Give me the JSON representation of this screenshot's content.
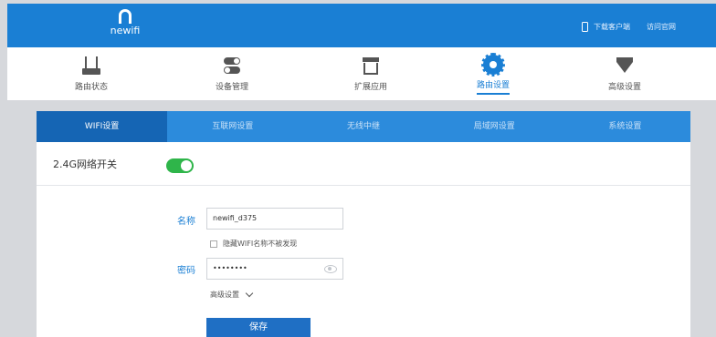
{
  "header": {
    "logo_text": "newifi",
    "links": [
      "下载客户端",
      "访问官网"
    ]
  },
  "nav": {
    "items": [
      {
        "label": "路由状态",
        "icon": "router-icon"
      },
      {
        "label": "设备管理",
        "icon": "toggle-icon"
      },
      {
        "label": "扩展应用",
        "icon": "store-icon"
      },
      {
        "label": "路由设置",
        "icon": "gear-icon",
        "active": true
      },
      {
        "label": "高级设置",
        "icon": "diamond-icon"
      }
    ]
  },
  "subtabs": [
    "WIFI设置",
    "互联网设置",
    "无线中继",
    "局域网设置",
    "系统设置"
  ],
  "wifi": {
    "toggle_label": "2.4G网络开关",
    "toggle_on": true,
    "name_label": "名称",
    "name_value": "newifi_d375",
    "hide_label": "隐藏WIFI名称不被发现",
    "password_label": "密码",
    "password_value": "••••••••",
    "advanced_label": "高级设置",
    "save_label": "保存"
  },
  "colors": {
    "brand": "#1a7fd4",
    "toggle_on": "#2fb54a",
    "save": "#1f6fc4"
  }
}
